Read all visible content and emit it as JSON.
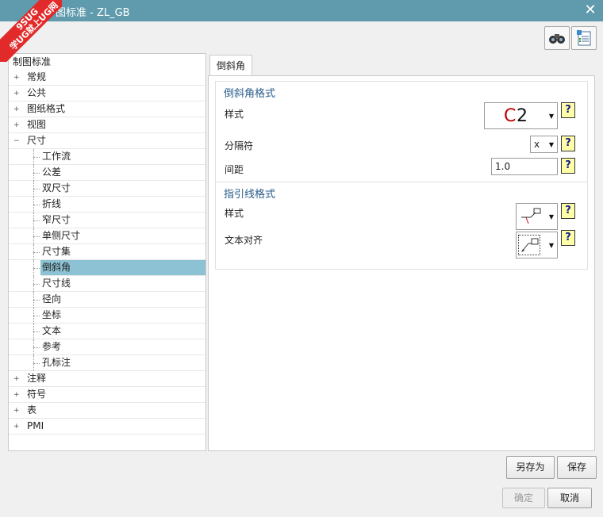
{
  "window": {
    "title": "图标准 - ZL_GB",
    "watermark_line1": "9SUG",
    "watermark_line2": "学UG就上UG网"
  },
  "tree": {
    "root": "制图标准",
    "items": [
      {
        "label": "常规",
        "level": 1,
        "expander": "+"
      },
      {
        "label": "公共",
        "level": 1,
        "expander": "+"
      },
      {
        "label": "图纸格式",
        "level": 1,
        "expander": "+"
      },
      {
        "label": "视图",
        "level": 1,
        "expander": "+"
      },
      {
        "label": "尺寸",
        "level": 1,
        "expander": "−"
      },
      {
        "label": "工作流",
        "level": 2
      },
      {
        "label": "公差",
        "level": 2
      },
      {
        "label": "双尺寸",
        "level": 2
      },
      {
        "label": "折线",
        "level": 2
      },
      {
        "label": "窄尺寸",
        "level": 2
      },
      {
        "label": "单侧尺寸",
        "level": 2
      },
      {
        "label": "尺寸集",
        "level": 2
      },
      {
        "label": "倒斜角",
        "level": 2,
        "selected": true
      },
      {
        "label": "尺寸线",
        "level": 2
      },
      {
        "label": "径向",
        "level": 2
      },
      {
        "label": "坐标",
        "level": 2
      },
      {
        "label": "文本",
        "level": 2
      },
      {
        "label": "参考",
        "level": 2
      },
      {
        "label": "孔标注",
        "level": 2
      },
      {
        "label": "注释",
        "level": 1,
        "expander": "+"
      },
      {
        "label": "符号",
        "level": 1,
        "expander": "+"
      },
      {
        "label": "表",
        "level": 1,
        "expander": "+"
      },
      {
        "label": "PMI",
        "level": 1,
        "expander": "+"
      }
    ]
  },
  "tab": {
    "label": "倒斜角"
  },
  "chamfer_format": {
    "title": "倒斜角格式",
    "style_label": "样式",
    "style_value_c": "C",
    "style_value_n": "2",
    "separator_label": "分隔符",
    "separator_value": "x",
    "spacing_label": "间距",
    "spacing_value": "1.0"
  },
  "leader_format": {
    "title": "指引线格式",
    "style_label": "样式",
    "text_align_label": "文本对齐"
  },
  "help_glyph": "?",
  "buttons": {
    "save_as": "另存为",
    "save": "保存",
    "ok": "确定",
    "cancel": "取消"
  },
  "colors": {
    "titlebar": "#5f9aad",
    "selection": "#8cc2d3",
    "group_title": "#2a5c8a",
    "chamfer_c": "#c00000"
  }
}
